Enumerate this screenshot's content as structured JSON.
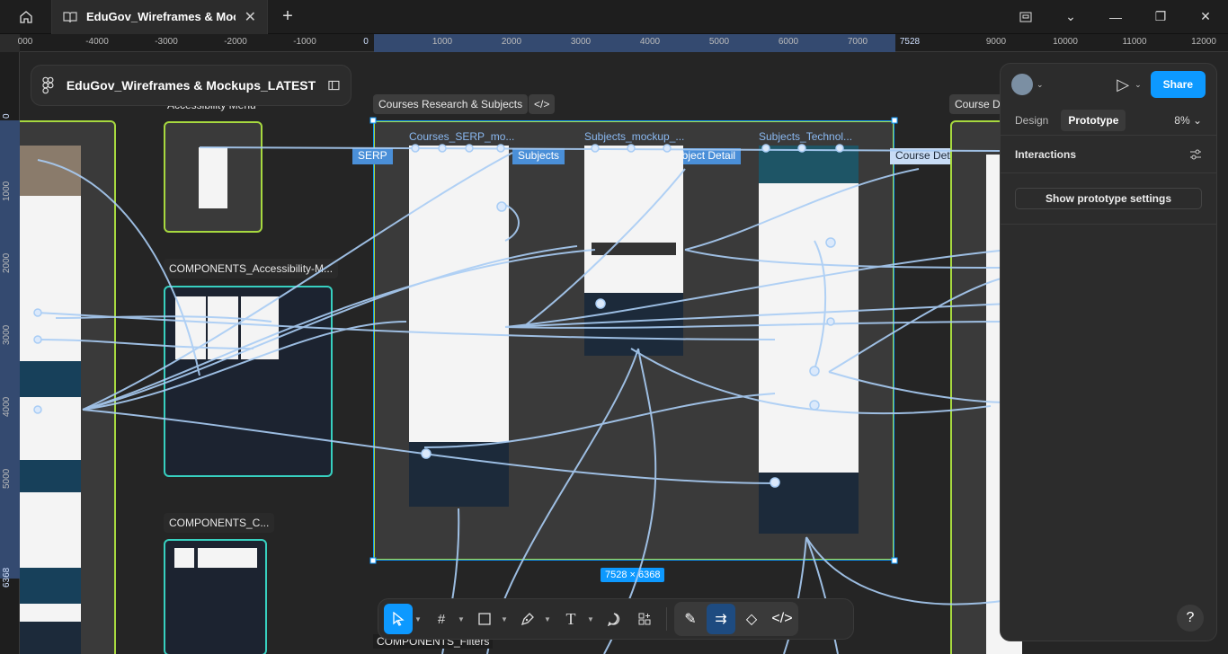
{
  "app": {
    "tab_title": "EduGov_Wireframes & Mockups_LATEST",
    "tab_title_display": "EduGov_Wireframes & Mockups_L"
  },
  "file": {
    "name": "EduGov_Wireframes & Mockups_LATEST"
  },
  "ruler": {
    "top_ticks": [
      "000",
      "-4000",
      "-3000",
      "-2000",
      "-1000",
      "0",
      "1000",
      "2000",
      "3000",
      "4000",
      "5000",
      "6000",
      "7000",
      "7528",
      "9000",
      "10000",
      "11000",
      "12000"
    ],
    "left_ticks": [
      "0",
      "1000",
      "2000",
      "3000",
      "4000",
      "5000",
      "6368"
    ]
  },
  "canvas": {
    "frames": {
      "accessibility_menu": "Accessibility Menu",
      "components_accessibility": "COMPONENTS_Accessibility-M...",
      "components_c": "COMPONENTS_C...",
      "components_filters": "COMPONENTS_Filters",
      "course_detail_section": "Course De"
    },
    "section": {
      "title": "Courses Research & Subjects",
      "size": "7528 × 6368"
    },
    "pages": {
      "serp": "Courses_SERP_mo...",
      "subjects": "Subjects_mockup_...",
      "technology": "Subjects_Technol..."
    },
    "flow_tags": {
      "serp": "SERP",
      "subjects": "Subjects",
      "subject_detail": "Subject Detail",
      "course_detail": "Course Detail"
    }
  },
  "panel": {
    "share_label": "Share",
    "tabs": [
      "Design",
      "Prototype"
    ],
    "active_tab": "Prototype",
    "zoom": "8%",
    "interactions_label": "Interactions",
    "prototype_settings_label": "Show prototype settings",
    "help": "?"
  },
  "toolbar": {
    "tools": [
      "move-tool",
      "frame-tool",
      "shape-tool",
      "pen-tool",
      "text-tool",
      "comment-tool",
      "actions-tool"
    ],
    "dev_tools": [
      "draw-mode",
      "prototype-mode",
      "component-mode",
      "dev-mode"
    ]
  },
  "colors": {
    "selection": "#0d99ff",
    "section_border": "#a7d93f",
    "component_border": "#37d0c0",
    "wire": "#a9cdf5"
  }
}
